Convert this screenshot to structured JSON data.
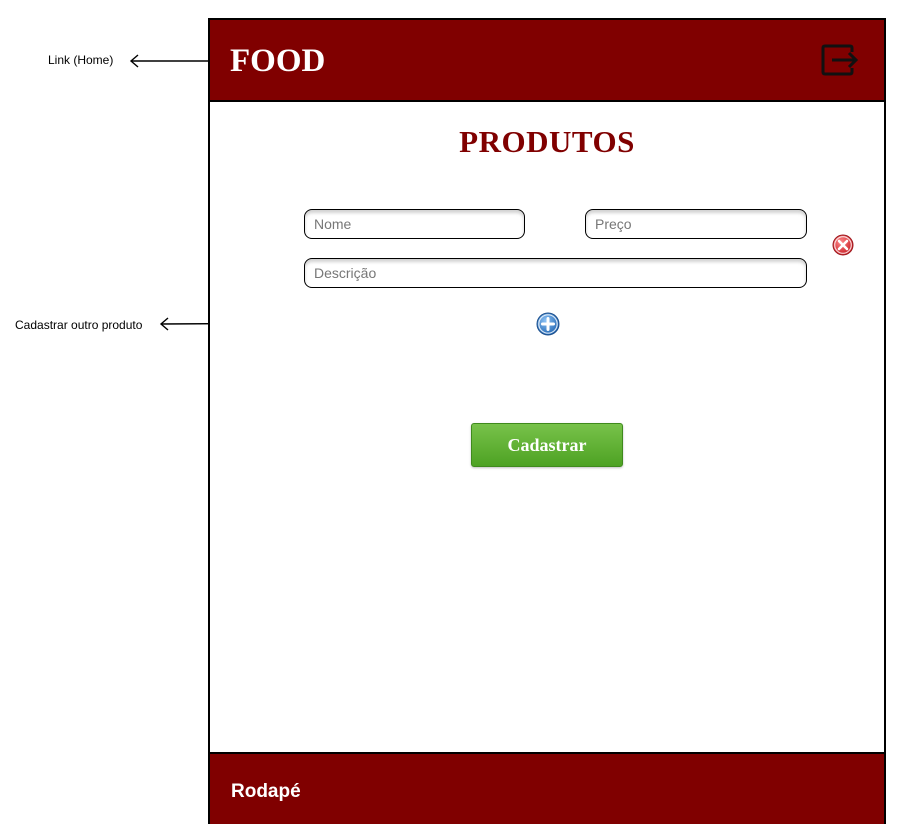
{
  "header": {
    "brand": "FOOD",
    "logout_icon": "logout-icon"
  },
  "main": {
    "title": "PRODUTOS",
    "fields": {
      "nome_placeholder": "Nome",
      "preco_placeholder": "Preço",
      "descricao_placeholder": "Descrição"
    },
    "remove_icon": "remove-icon",
    "add_icon": "add-icon",
    "submit_label": "Cadastrar"
  },
  "footer": {
    "text": "Rodapé"
  },
  "annotations": {
    "home_link": "Link (Home)",
    "add_product": "Cadastrar outro produto"
  },
  "colors": {
    "brand": "#800000",
    "button_green": "#5aaa2c",
    "remove_red": "#d9363e",
    "add_blue": "#2f78c4"
  }
}
